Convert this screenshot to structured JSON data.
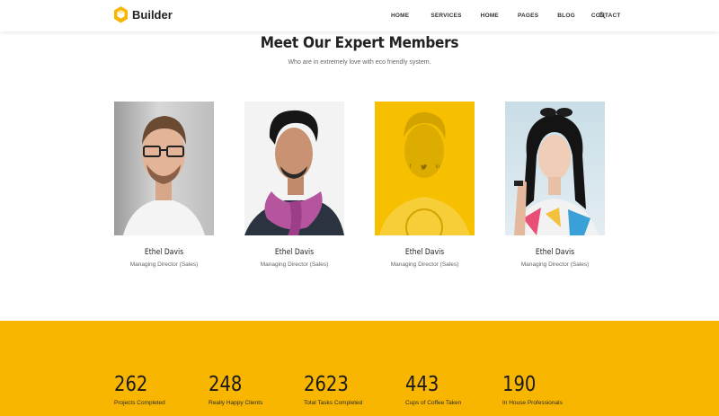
{
  "header": {
    "brand": "Builder",
    "nav": [
      "HOME",
      "SERVICES",
      "HOME",
      "PAGES",
      "BLOG",
      "CONTACT"
    ]
  },
  "team": {
    "title": "Meet Our Expert Members",
    "subtitle": "Who are in extremely love with eco friendly system.",
    "members": [
      {
        "name": "Ethel Davis",
        "role": "Managing Director (Sales)"
      },
      {
        "name": "Ethel Davis",
        "role": "Managing Director (Sales)"
      },
      {
        "name": "Ethel Davis",
        "role": "Managing Director (Sales)"
      },
      {
        "name": "Ethel Davis",
        "role": "Managing Director (Sales)"
      }
    ],
    "social": [
      "f",
      "t",
      "in"
    ]
  },
  "stats": [
    {
      "value": "262",
      "label": "Projects Completed"
    },
    {
      "value": "248",
      "label": "Really Happy Clients"
    },
    {
      "value": "2623",
      "label": "Total Tasks Completed"
    },
    {
      "value": "443",
      "label": "Cups of Coffee Taken"
    },
    {
      "value": "190",
      "label": "In House Professionals"
    }
  ],
  "colors": {
    "accent": "#f8b600",
    "text": "#222222",
    "muted": "#666666"
  }
}
